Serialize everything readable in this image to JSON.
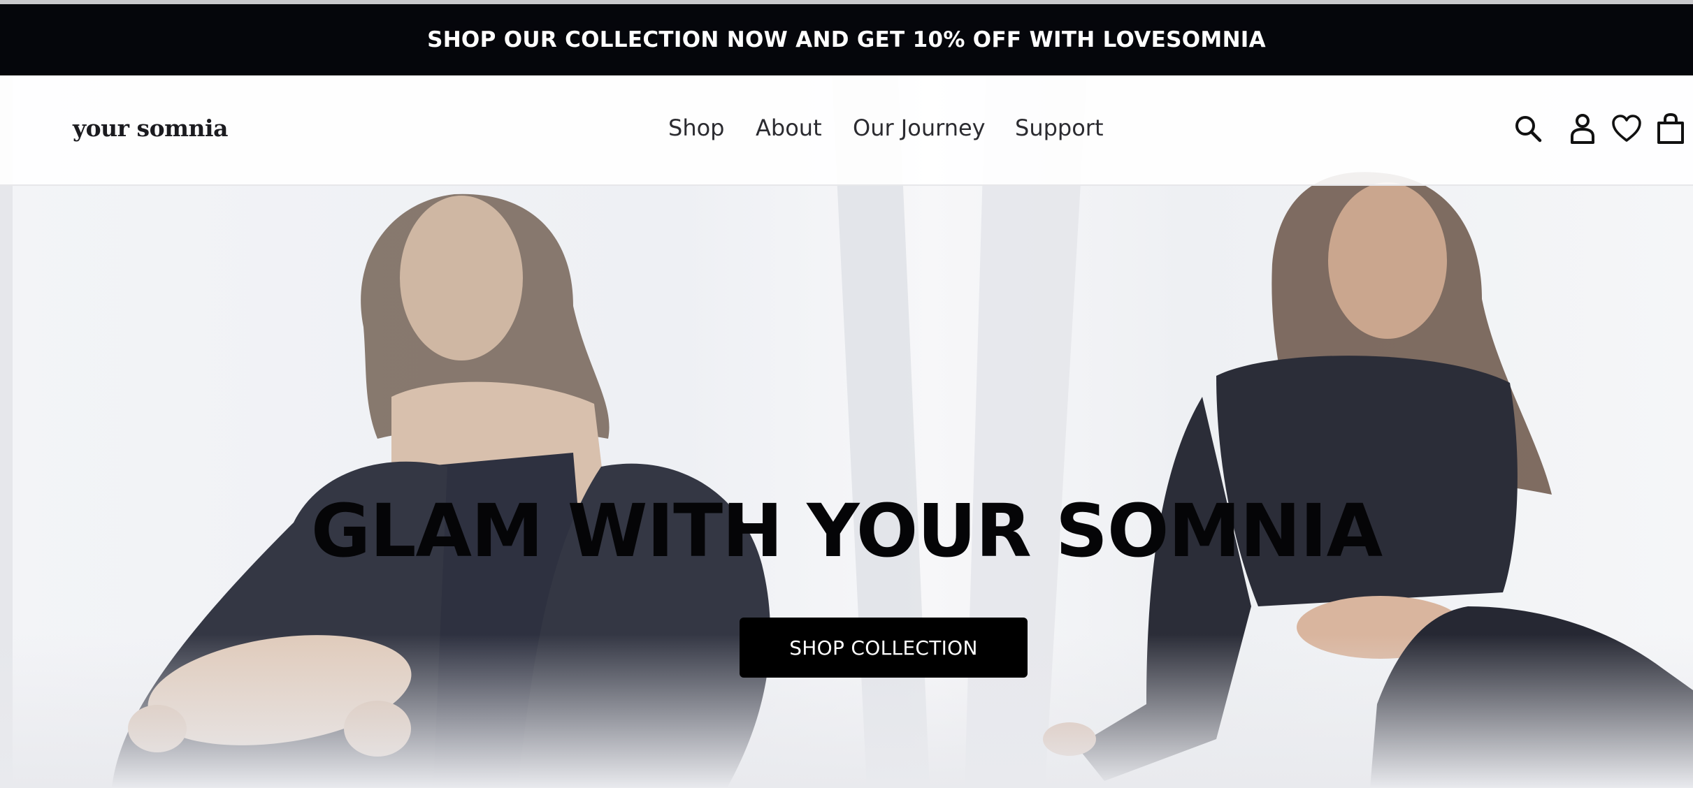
{
  "announcement": {
    "text": "SHOP OUR COLLECTION NOW AND GET 10% OFF WITH LOVESOMNIA"
  },
  "brand": {
    "name": "your somnia"
  },
  "nav": {
    "items": [
      {
        "label": "Shop"
      },
      {
        "label": "About"
      },
      {
        "label": "Our Journey"
      },
      {
        "label": "Support"
      }
    ]
  },
  "header_icons": [
    "search-icon",
    "account-icon",
    "wishlist-icon",
    "cart-icon"
  ],
  "hero": {
    "image": "two-models-in-black-outfits",
    "title": "GLAM WITH YOUR SOMNIA",
    "cta_label": "SHOP COLLECTION"
  },
  "colors": {
    "announcement_bg": "#05060b",
    "text_dark": "#050507",
    "button_bg": "#000000",
    "button_text": "#ffffff"
  }
}
